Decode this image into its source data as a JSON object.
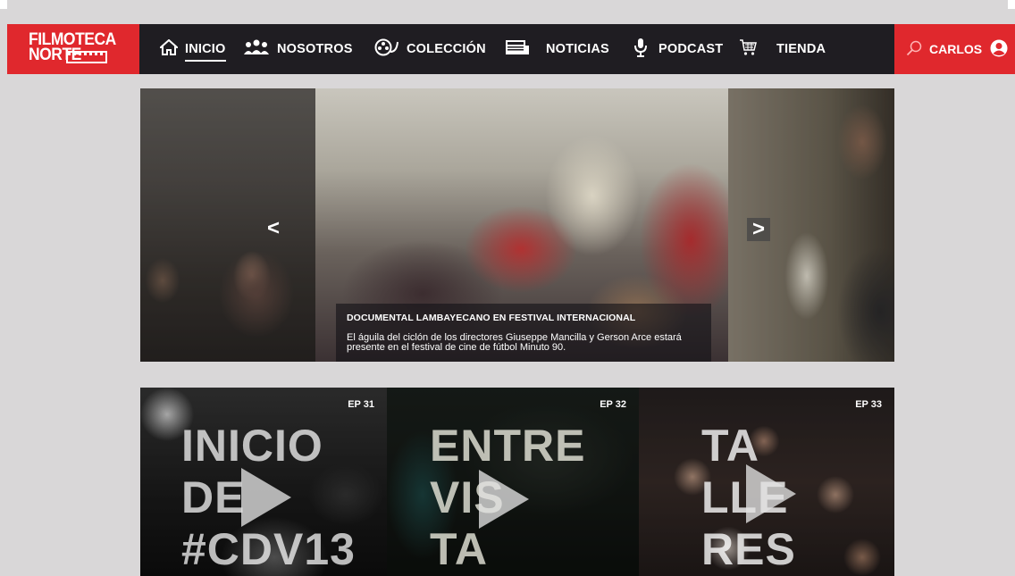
{
  "brand": {
    "line1": "FILMOTECA",
    "line2": "NORTE"
  },
  "nav": {
    "items": [
      {
        "label": "INICIO",
        "icon": "home-icon",
        "active": true
      },
      {
        "label": "NOSOTROS",
        "icon": "people-icon"
      },
      {
        "label": "COLECCIÓN",
        "icon": "film-reel-icon"
      },
      {
        "label": "NOTICIAS",
        "icon": "newspaper-icon"
      },
      {
        "label": "PODCAST",
        "icon": "microphone-icon"
      },
      {
        "label": "TIENDA",
        "icon": "cart-icon"
      }
    ]
  },
  "user": {
    "name": "CARLOS",
    "search_icon": "search-icon",
    "avatar_icon": "user-avatar-icon"
  },
  "slider": {
    "prev": "<",
    "next": ">",
    "caption": {
      "title": "DOCUMENTAL LAMBAYECANO EN FESTIVAL INTERNACIONAL",
      "description": "El águila del ciclón de los directores Giuseppe Mancilla y Gerson Arce estará presente en el festival de cine de fútbol Minuto 90."
    }
  },
  "episodes": [
    {
      "label": "EP 31",
      "title": "INICIO\nDE\n#CDV13"
    },
    {
      "label": "EP 32",
      "title": "ENTRE\nVIS\nTA"
    },
    {
      "label": "EP 33",
      "title": "TA\nLLE\nRES"
    }
  ],
  "colors": {
    "brand_red": "#e0282d",
    "nav_dark": "#1f1d22",
    "page_bg": "#d9d7d8"
  }
}
